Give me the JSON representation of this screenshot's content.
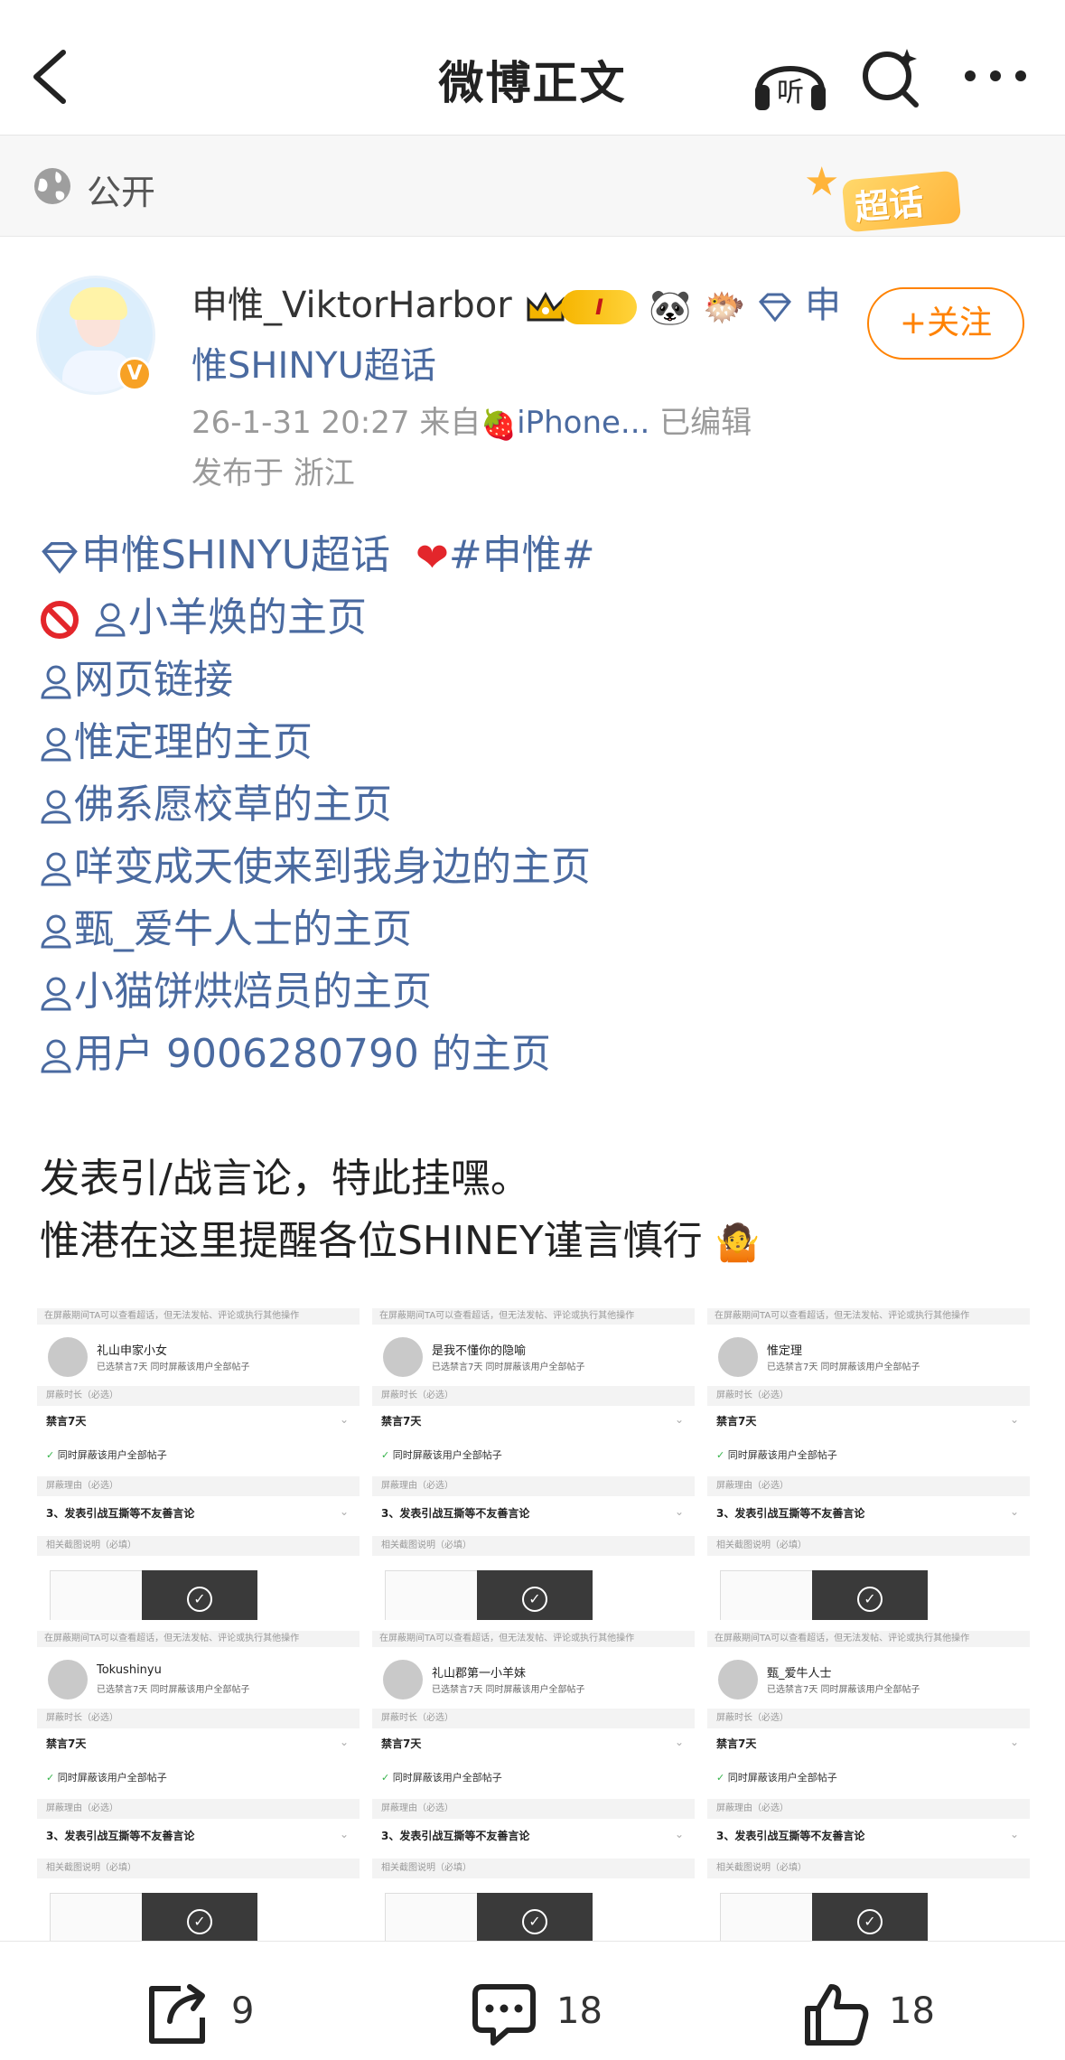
{
  "header": {
    "title": "微博正文",
    "listen_label": "听"
  },
  "visibility": {
    "label": "公开",
    "supertopic_badge": "超话"
  },
  "author": {
    "name": "申惟_ViktorHarbor",
    "rank_badge": "I",
    "topic_head": "申",
    "topic_rest": "惟SHINYU超话",
    "timestamp": "26-1-31 20:27",
    "source_prefix": "来自",
    "source": "iPhone...",
    "edited": "已编辑",
    "location": "发布于 浙江",
    "follow_label": "+关注"
  },
  "post": {
    "line1_topic": "申惟SHINYU超话",
    "line1_hashtag": "#申惟#",
    "line2": "小羊焕的主页",
    "line3": "网页链接",
    "line4": "惟定理的主页",
    "line5": "佛系愿校草的主页",
    "line6": "咩变成天使来到我身边的主页",
    "line7": "甄_爱牛人士的主页",
    "line8": "小猫饼烘焙员的主页",
    "line9": "用户 9006280790 的主页",
    "para1": "发表引/战言论，特此挂嘿。",
    "para2": "惟港在这里提醒各位SHINEY谨言慎行"
  },
  "screenshots": {
    "header_note": "在屏蔽期间TA可以查看超话，但无法发帖、评论或执行其他操作",
    "sub_note": "已选禁言7天 同时屏蔽该用户全部帖子",
    "duration_label": "屏蔽时长（必选）",
    "duration_value": "禁言7天",
    "also_block": "同时屏蔽该用户全部帖子",
    "reason_label": "屏蔽理由（必选）",
    "reason_value": "3、发表引战互撕等不友善言论",
    "evidence_label": "相关截图说明（必填）",
    "users": [
      "礼山申家小女",
      "是我不懂你的隐喻",
      "惟定理",
      "Tokushinyu",
      "礼山郡第一小羊妹",
      "甄_爱牛人士"
    ]
  },
  "actions": {
    "repost_count": "9",
    "comment_count": "18",
    "like_count": "18"
  },
  "colors": {
    "link": "#4a6aa0",
    "accent_orange": "#ff8200",
    "verified": "#f7a125"
  }
}
